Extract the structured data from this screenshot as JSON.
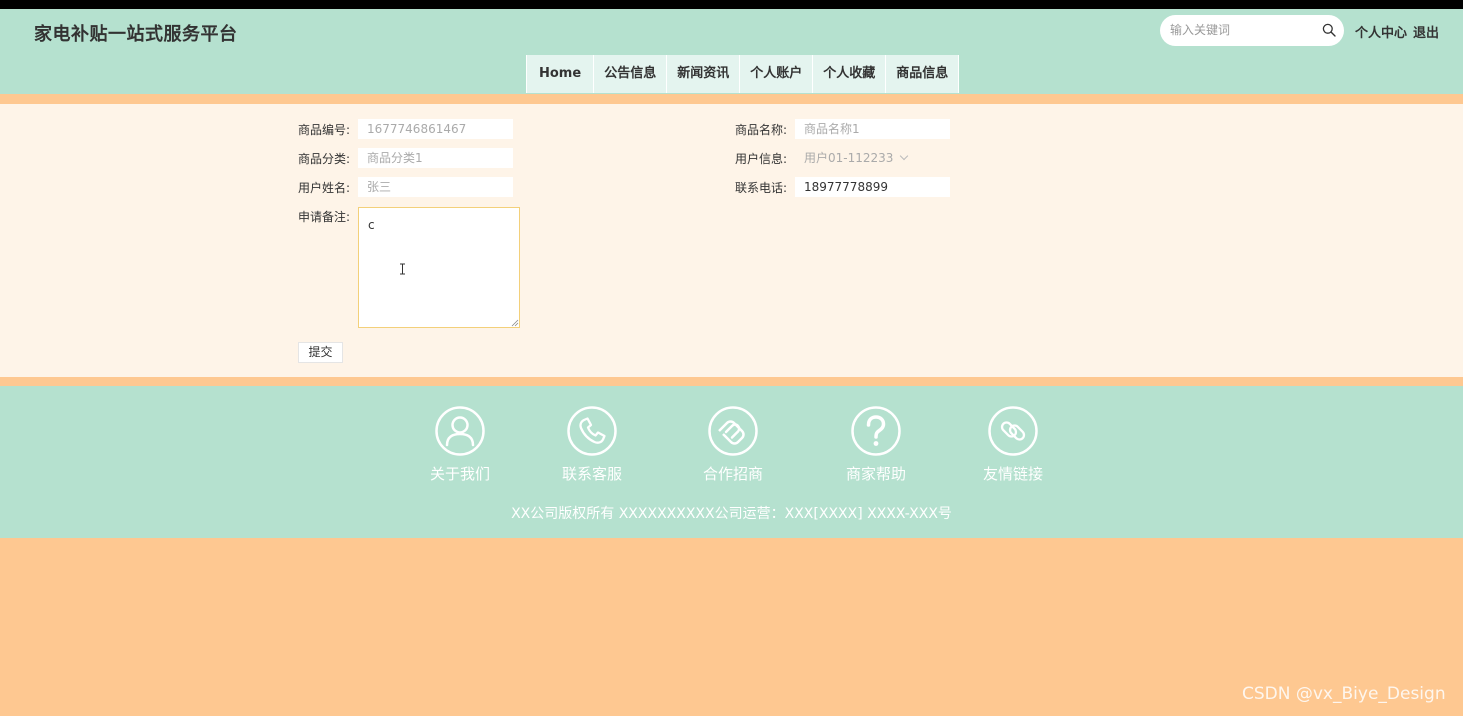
{
  "header": {
    "site_title": "家电补贴一站式服务平台",
    "search_placeholder": "输入关键词",
    "links": {
      "personal_center": "个人中心",
      "logout": "退出"
    }
  },
  "nav": {
    "items": [
      {
        "label": "Home"
      },
      {
        "label": "公告信息"
      },
      {
        "label": "新闻资讯"
      },
      {
        "label": "个人账户"
      },
      {
        "label": "个人收藏"
      },
      {
        "label": "商品信息"
      }
    ]
  },
  "form": {
    "product_no_label": "商品编号:",
    "product_no_value": "1677746861467",
    "product_name_label": "商品名称:",
    "product_name_value": "商品名称1",
    "product_category_label": "商品分类:",
    "product_category_value": "商品分类1",
    "user_info_label": "用户信息:",
    "user_info_value": "用户01-112233",
    "user_name_label": "用户姓名:",
    "user_name_value": "张三",
    "phone_label": "联系电话:",
    "phone_value": "18977778899",
    "remark_label": "申请备注:",
    "remark_value": "c",
    "submit_label": "提交"
  },
  "footer": {
    "items": [
      {
        "label": "关于我们",
        "icon": "user-icon"
      },
      {
        "label": "联系客服",
        "icon": "phone-icon"
      },
      {
        "label": "合作招商",
        "icon": "handshake-icon"
      },
      {
        "label": "商家帮助",
        "icon": "question-icon"
      },
      {
        "label": "友情链接",
        "icon": "link-icon"
      }
    ],
    "copyright": "XX公司版权所有 XXXXXXXXXX公司运营：XXX[XXXX] XXXX-XXX号"
  },
  "watermark": "CSDN @vx_Biye_Design",
  "colors": {
    "header_bg": "#b5e1cf",
    "page_bg": "#fec891",
    "content_bg": "#fef4e8",
    "nav_bg": "#e4f4ef",
    "remark_border": "#f3d07a"
  }
}
